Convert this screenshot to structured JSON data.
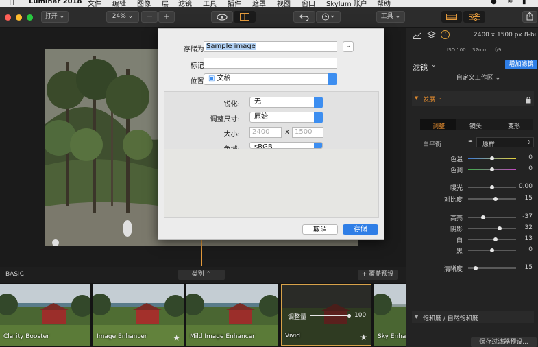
{
  "menubar": {
    "app": "Luminar 2018",
    "items": [
      "文件",
      "编辑",
      "图像",
      "层",
      "滤镜",
      "工具",
      "插件",
      "遮罩",
      "视图",
      "窗口",
      "Skylum 账户",
      "帮助"
    ]
  },
  "toolbar": {
    "open_label": "打开",
    "zoom_label": "24%",
    "zoom_out": "—",
    "zoom_in": "+",
    "tools_label": "工具"
  },
  "dialog": {
    "save_as_label": "存储为:",
    "save_as_value": "Sample image",
    "tags_label": "标记:",
    "tags_value": "",
    "location_label": "位置:",
    "location_value": "文稿",
    "sharpen_label": "锐化:",
    "sharpen_value": "无",
    "resize_label": "调整尺寸:",
    "resize_value": "原始",
    "size_label": "大小:",
    "width_placeholder": "2400",
    "times": "x",
    "height_placeholder": "1500",
    "colorspace_label": "色域:",
    "colorspace_value": "sRGB",
    "cancel_label": "取消",
    "save_label": "存储"
  },
  "strip": {
    "section_label": "BASIC",
    "category_label": "类别",
    "override_label": "+ 覆盖预设",
    "thumbs": [
      {
        "label": "Clarity Booster"
      },
      {
        "label": "Image Enhancer"
      },
      {
        "label": "Mild Image Enhancer"
      },
      {
        "label": "Vivid"
      },
      {
        "label": "Sky Enhan"
      }
    ],
    "amount_label": "调整量",
    "amount_value": "100",
    "amount_fraction": 1.0
  },
  "panel": {
    "dimensions": "2400 x 1500 px",
    "bitdepth": "8-bi",
    "iso": "ISO 100",
    "focal": "32mm",
    "fstop": "f/9",
    "filters_label": "滤镜",
    "add_filter_label": "增加滤镜",
    "workspace_label": "自定义工作区",
    "develop_label": "发展",
    "tabs": [
      "调整",
      "镜头",
      "变形"
    ],
    "wb_label": "白平衡",
    "wb_value": "原样",
    "saturation_label": "饱和度 / 自然饱和度",
    "save_filters_label": "保存过滤器预设...",
    "sliders": [
      {
        "label": "色温",
        "value": "0",
        "pos": 0.5,
        "track": "temp"
      },
      {
        "label": "色调",
        "value": "0",
        "pos": 0.5,
        "track": "tint"
      },
      {
        "label": "曝光",
        "value": "0.00",
        "pos": 0.5,
        "track": "plain"
      },
      {
        "label": "对比度",
        "value": "15",
        "pos": 0.575,
        "track": "plain"
      },
      {
        "label": "高亮",
        "value": "-37",
        "pos": 0.315,
        "track": "plain"
      },
      {
        "label": "阴影",
        "value": "32",
        "pos": 0.66,
        "track": "plain"
      },
      {
        "label": "白",
        "value": "13",
        "pos": 0.565,
        "track": "plain"
      },
      {
        "label": "黑",
        "value": "0",
        "pos": 0.5,
        "track": "plain"
      },
      {
        "label": "清晰度",
        "value": "15",
        "pos": 0.15,
        "track": "plain"
      }
    ]
  },
  "colors": {
    "accent_blue": "#2f7ee6",
    "thumb_selected_border": "#d7a24a",
    "dev_orange": "#e08a2e"
  }
}
